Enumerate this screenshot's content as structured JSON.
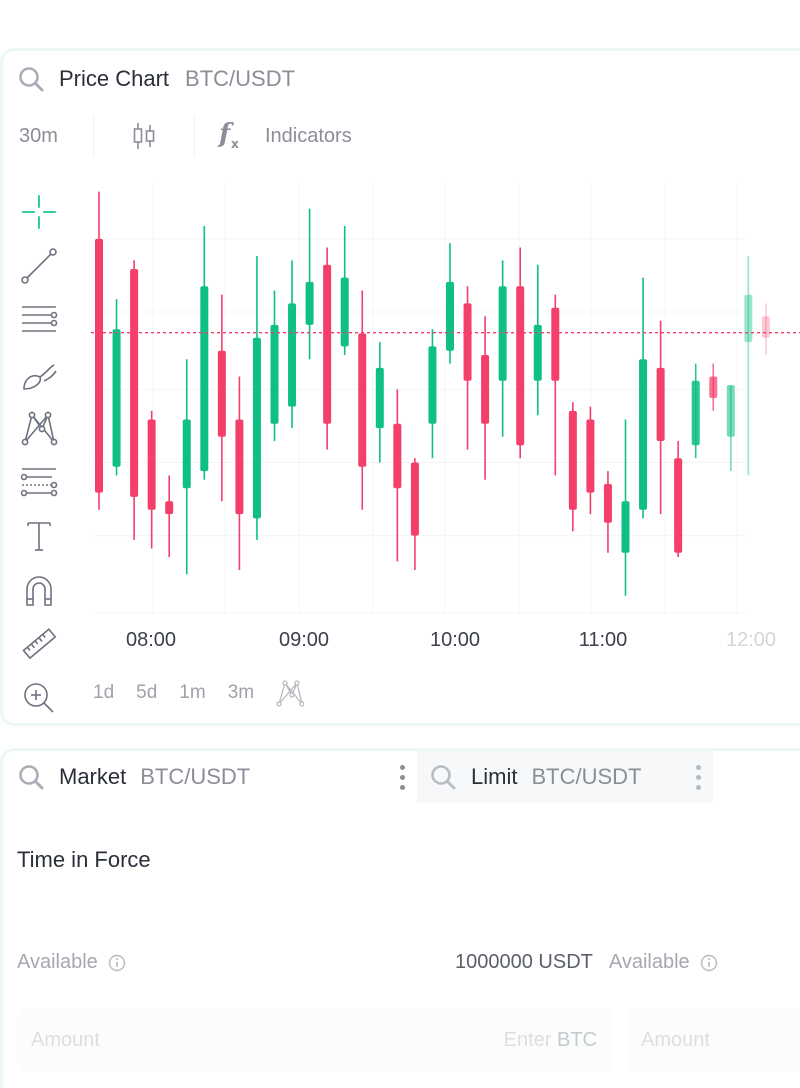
{
  "chart_panel": {
    "title": "Price Chart",
    "symbol": "BTC/USDT",
    "interval": "30m",
    "indicators_label": "Indicators",
    "time_labels": [
      "08:00",
      "09:00",
      "10:00",
      "11:00",
      "12:00"
    ],
    "ranges": [
      "1d",
      "5d",
      "1m",
      "3m"
    ],
    "drawing_tools": [
      "crosshair-icon",
      "trend-line-icon",
      "horizontal-lines-icon",
      "brush-icon",
      "pattern-icon",
      "fib-retracement-icon",
      "text-icon",
      "magnet-icon",
      "ruler-icon",
      "zoom-in-icon"
    ],
    "colors": {
      "up": "#0fbf85",
      "down": "#f43f6b",
      "last_price_line": "#f43f6b"
    }
  },
  "chart_data": {
    "type": "candlestick",
    "x_ticks": [
      "08:00",
      "09:00",
      "10:00",
      "11:00",
      "12:00"
    ],
    "last_price_relative": 0.652,
    "candles": [
      {
        "o": 0.87,
        "c": 0.28,
        "h": 0.98,
        "l": 0.24,
        "dir": "down"
      },
      {
        "o": 0.34,
        "c": 0.66,
        "h": 0.73,
        "l": 0.32,
        "dir": "up"
      },
      {
        "o": 0.8,
        "c": 0.27,
        "h": 0.82,
        "l": 0.17,
        "dir": "down"
      },
      {
        "o": 0.45,
        "c": 0.24,
        "h": 0.47,
        "l": 0.15,
        "dir": "down"
      },
      {
        "o": 0.26,
        "c": 0.23,
        "h": 0.32,
        "l": 0.13,
        "dir": "down"
      },
      {
        "o": 0.29,
        "c": 0.45,
        "h": 0.59,
        "l": 0.09,
        "dir": "up"
      },
      {
        "o": 0.33,
        "c": 0.76,
        "h": 0.9,
        "l": 0.31,
        "dir": "up"
      },
      {
        "o": 0.41,
        "c": 0.61,
        "h": 0.74,
        "l": 0.26,
        "dir": "down"
      },
      {
        "o": 0.23,
        "c": 0.45,
        "h": 0.55,
        "l": 0.1,
        "dir": "down"
      },
      {
        "o": 0.22,
        "c": 0.64,
        "h": 0.83,
        "l": 0.17,
        "dir": "up"
      },
      {
        "o": 0.44,
        "c": 0.67,
        "h": 0.75,
        "l": 0.4,
        "dir": "up"
      },
      {
        "o": 0.48,
        "c": 0.72,
        "h": 0.82,
        "l": 0.43,
        "dir": "up"
      },
      {
        "o": 0.67,
        "c": 0.77,
        "h": 0.94,
        "l": 0.59,
        "dir": "up"
      },
      {
        "o": 0.44,
        "c": 0.81,
        "h": 0.85,
        "l": 0.38,
        "dir": "down"
      },
      {
        "o": 0.62,
        "c": 0.78,
        "h": 0.9,
        "l": 0.6,
        "dir": "up"
      },
      {
        "o": 0.34,
        "c": 0.65,
        "h": 0.75,
        "l": 0.24,
        "dir": "down"
      },
      {
        "o": 0.43,
        "c": 0.57,
        "h": 0.63,
        "l": 0.35,
        "dir": "up"
      },
      {
        "o": 0.44,
        "c": 0.29,
        "h": 0.52,
        "l": 0.12,
        "dir": "down"
      },
      {
        "o": 0.35,
        "c": 0.18,
        "h": 0.36,
        "l": 0.1,
        "dir": "down"
      },
      {
        "o": 0.44,
        "c": 0.62,
        "h": 0.66,
        "l": 0.36,
        "dir": "up"
      },
      {
        "o": 0.61,
        "c": 0.77,
        "h": 0.86,
        "l": 0.58,
        "dir": "up"
      },
      {
        "o": 0.54,
        "c": 0.72,
        "h": 0.76,
        "l": 0.38,
        "dir": "down"
      },
      {
        "o": 0.44,
        "c": 0.6,
        "h": 0.69,
        "l": 0.31,
        "dir": "down"
      },
      {
        "o": 0.54,
        "c": 0.76,
        "h": 0.82,
        "l": 0.41,
        "dir": "up"
      },
      {
        "o": 0.76,
        "c": 0.39,
        "h": 0.85,
        "l": 0.36,
        "dir": "down"
      },
      {
        "o": 0.54,
        "c": 0.67,
        "h": 0.81,
        "l": 0.46,
        "dir": "up"
      },
      {
        "o": 0.54,
        "c": 0.71,
        "h": 0.74,
        "l": 0.32,
        "dir": "down"
      },
      {
        "o": 0.47,
        "c": 0.24,
        "h": 0.49,
        "l": 0.19,
        "dir": "down"
      },
      {
        "o": 0.45,
        "c": 0.28,
        "h": 0.48,
        "l": 0.23,
        "dir": "down"
      },
      {
        "o": 0.3,
        "c": 0.21,
        "h": 0.33,
        "l": 0.14,
        "dir": "down"
      },
      {
        "o": 0.14,
        "c": 0.26,
        "h": 0.45,
        "l": 0.04,
        "dir": "up"
      },
      {
        "o": 0.24,
        "c": 0.59,
        "h": 0.78,
        "l": 0.22,
        "dir": "up"
      },
      {
        "o": 0.4,
        "c": 0.57,
        "h": 0.68,
        "l": 0.23,
        "dir": "down"
      },
      {
        "o": 0.36,
        "c": 0.14,
        "h": 0.4,
        "l": 0.13,
        "dir": "down"
      },
      {
        "o": 0.39,
        "c": 0.54,
        "h": 0.58,
        "l": 0.36,
        "dir": "up"
      },
      {
        "o": 0.55,
        "c": 0.5,
        "h": 0.58,
        "l": 0.47,
        "dir": "down"
      },
      {
        "o": 0.41,
        "c": 0.53,
        "h": 0.53,
        "l": 0.33,
        "dir": "up"
      },
      {
        "o": 0.63,
        "c": 0.74,
        "h": 0.83,
        "l": 0.32,
        "dir": "up"
      },
      {
        "o": 0.69,
        "c": 0.64,
        "h": 0.72,
        "l": 0.6,
        "dir": "down"
      }
    ]
  },
  "order_panel": {
    "market_tab": {
      "title": "Market",
      "symbol": "BTC/USDT"
    },
    "limit_tab": {
      "title": "Limit",
      "symbol": "BTC/USDT"
    },
    "time_in_force_label": "Time in Force",
    "available_label": "Available",
    "available_value": "1000000 USDT",
    "available_label_2": "Available",
    "amount_placeholder": "Amount",
    "enter_hint": "Enter",
    "enter_unit": "BTC",
    "amount_placeholder_2": "Amount"
  }
}
